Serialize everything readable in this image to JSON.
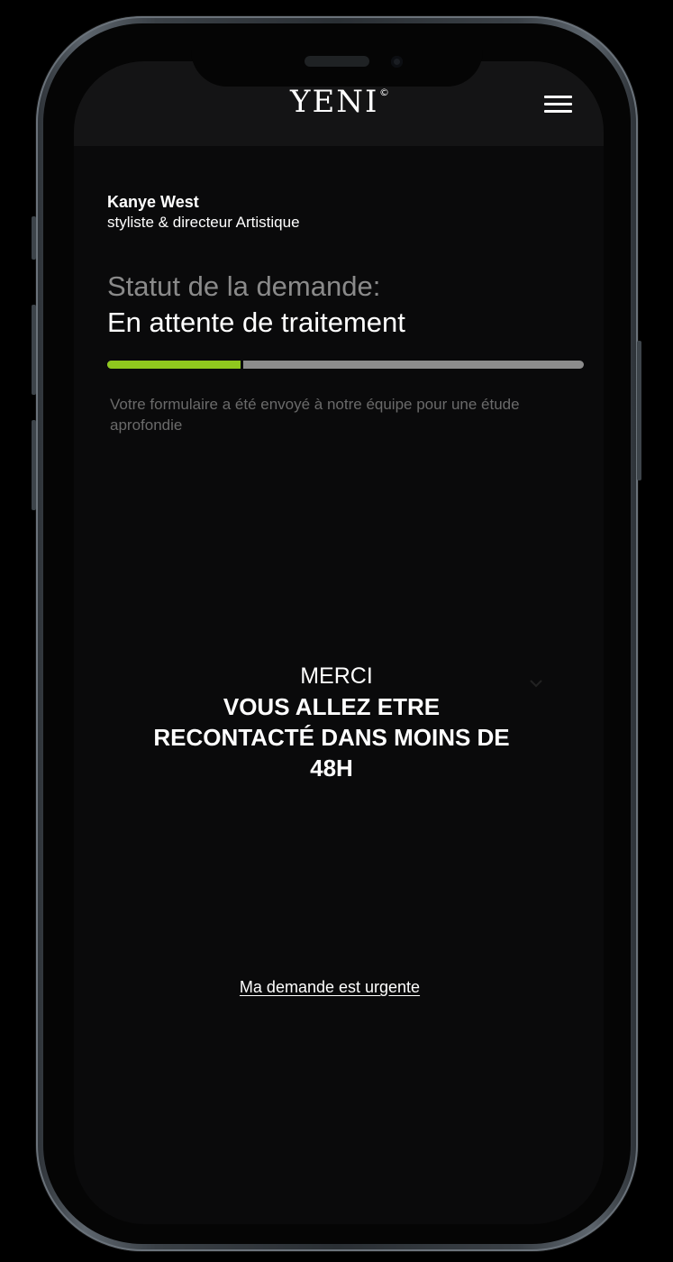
{
  "header": {
    "brand": "YENI",
    "brand_mark": "©",
    "menu_icon": "hamburger-menu-icon"
  },
  "profile": {
    "name": "Kanye West",
    "role": "styliste & directeur Artistique"
  },
  "request": {
    "status_label": "Statut de la demande:",
    "status_value": "En attente de traitement",
    "progress_fraction": 0.28,
    "info": "Votre formulaire a été envoyé à notre équipe pour une étude aprofondie",
    "accent_color": "#8fc81e",
    "track_color": "#8c8c8c"
  },
  "confirmation": {
    "intro": "MERCI",
    "message": "VOUS ALLEZ ETRE RECONTACTÉ DANS MOINS DE 48H",
    "chevron_icon": "chevron-down-icon"
  },
  "actions": {
    "urgent_link": "Ma demande est urgente"
  }
}
